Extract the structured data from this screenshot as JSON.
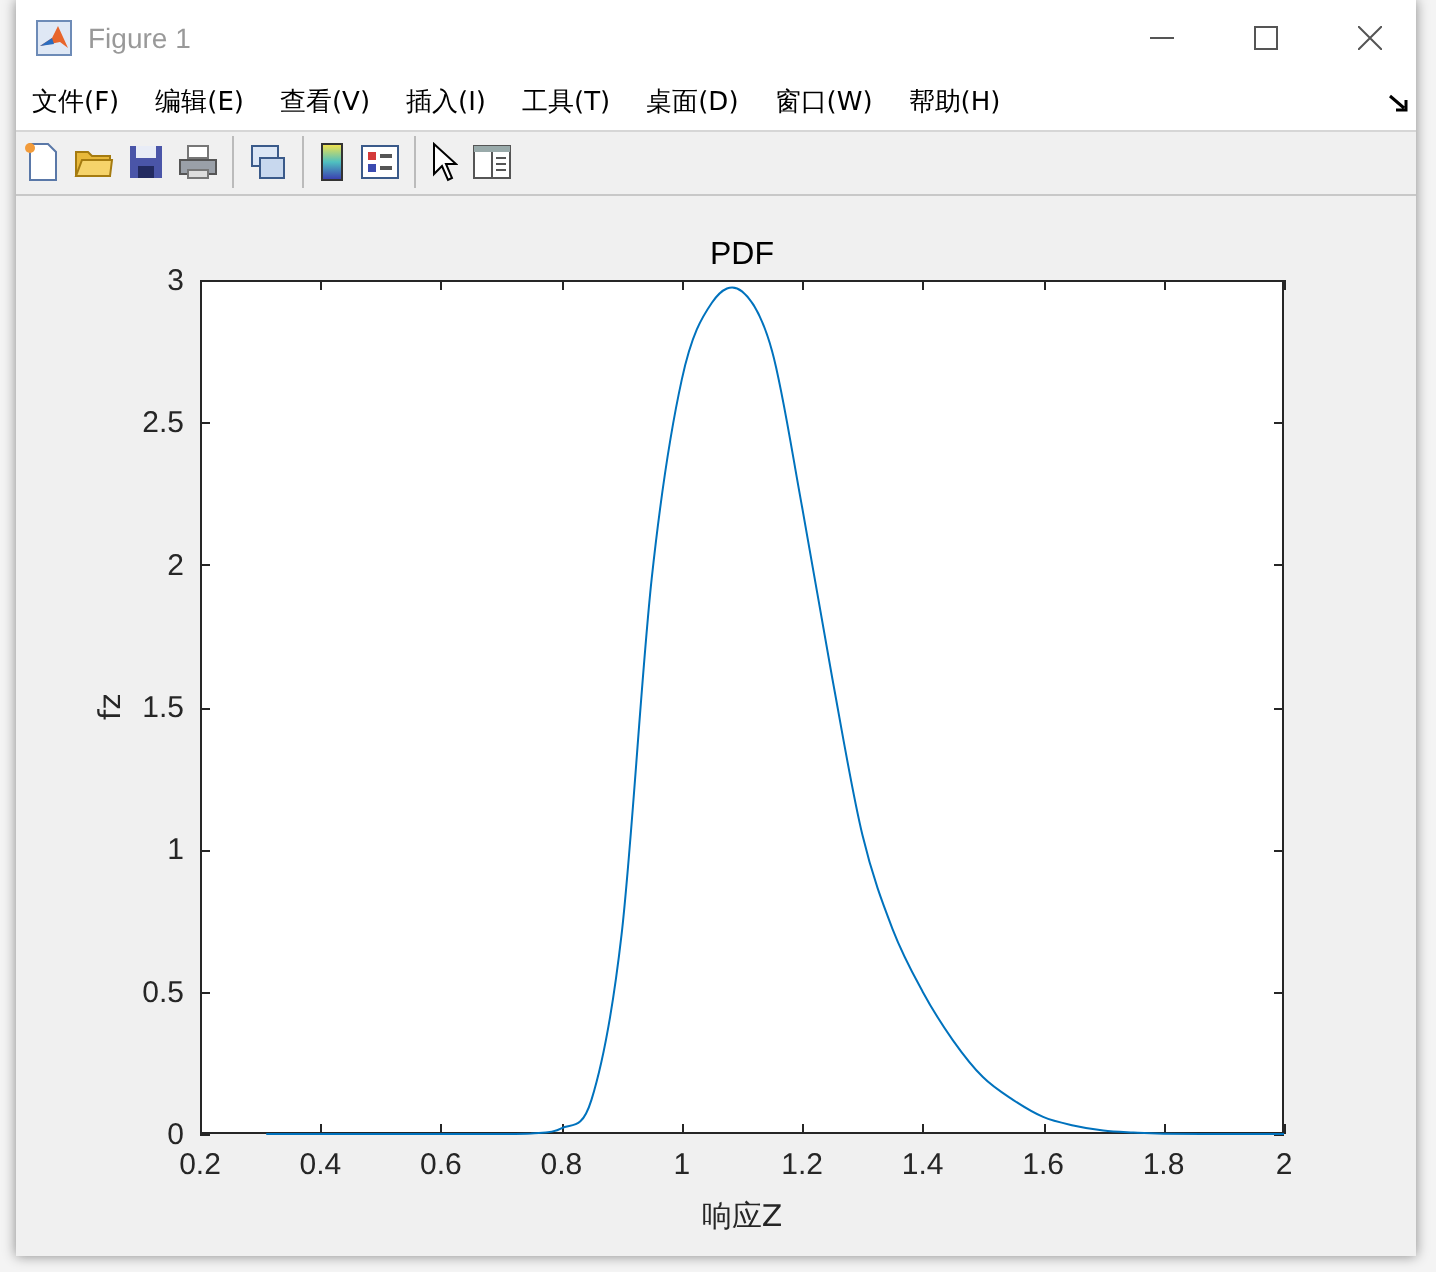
{
  "window": {
    "title": "Figure 1"
  },
  "menu": [
    "文件(F)",
    "编辑(E)",
    "查看(V)",
    "插入(I)",
    "工具(T)",
    "桌面(D)",
    "窗口(W)",
    "帮助(H)"
  ],
  "figure": {
    "chart_data": {
      "type": "line",
      "title": "PDF",
      "xlabel": "响应Z",
      "ylabel": "fz",
      "xlim": [
        0.2,
        2
      ],
      "ylim": [
        0,
        3
      ],
      "xticks": [
        {
          "value": 0.2,
          "label": "0.2"
        },
        {
          "value": 0.4,
          "label": "0.4"
        },
        {
          "value": 0.6,
          "label": "0.6"
        },
        {
          "value": 0.8,
          "label": "0.8"
        },
        {
          "value": 1,
          "label": "1"
        },
        {
          "value": 1.2,
          "label": "1.2"
        },
        {
          "value": 1.4,
          "label": "1.4"
        },
        {
          "value": 1.6,
          "label": "1.6"
        },
        {
          "value": 1.8,
          "label": "1.8"
        },
        {
          "value": 2,
          "label": "2"
        }
      ],
      "yticks": [
        {
          "value": 0,
          "label": "0"
        },
        {
          "value": 0.5,
          "label": "0.5"
        },
        {
          "value": 1,
          "label": "1"
        },
        {
          "value": 1.5,
          "label": "1.5"
        },
        {
          "value": 2,
          "label": "2"
        },
        {
          "value": 2.5,
          "label": "2.5"
        },
        {
          "value": 3,
          "label": "3"
        }
      ],
      "x": [
        0.31,
        0.4,
        0.5,
        0.6,
        0.7,
        0.75,
        0.8,
        0.85,
        0.9,
        0.95,
        1.0,
        1.05,
        1.1,
        1.15,
        1.2,
        1.25,
        1.3,
        1.35,
        1.4,
        1.45,
        1.5,
        1.55,
        1.6,
        1.65,
        1.7,
        1.75,
        1.8,
        1.9,
        2.0
      ],
      "series": [
        {
          "color": "#0072bd",
          "values": [
            0,
            0,
            0,
            0,
            0,
            0.002,
            0.02,
            0.12,
            0.7,
            1.95,
            2.65,
            2.92,
            2.96,
            2.75,
            2.2,
            1.6,
            1.05,
            0.72,
            0.5,
            0.33,
            0.2,
            0.12,
            0.06,
            0.03,
            0.012,
            0.005,
            0.001,
            0,
            0
          ]
        }
      ]
    }
  }
}
